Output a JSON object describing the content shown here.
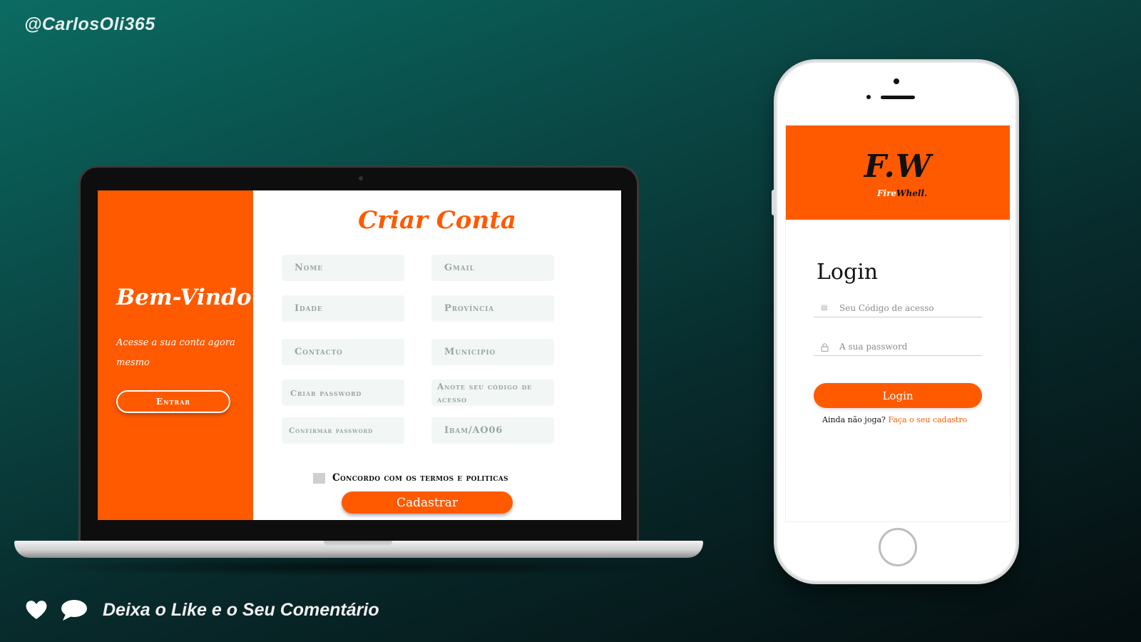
{
  "handle": "@CarlosOli365",
  "laptop": {
    "welcome": {
      "title": "Bem-Vindo",
      "subtitle": "Acesse a sua conta agora mesmo",
      "enter_button": "Entrar"
    },
    "form": {
      "title": "Criar Conta",
      "fields": {
        "nome": "Nome",
        "gmail": "Gmail",
        "idade": "Idade",
        "provincia": "Província",
        "contacto": "Contacto",
        "municipio": "Municipio",
        "criar_password": "Criar password",
        "codigo_acesso": "Anote seu código de acesso",
        "confirmar_password": "Confirmar password",
        "iban": "Ibam/AO06"
      },
      "agree_label": "Concordo com os termos e politicas",
      "submit_button": "Cadastrar"
    }
  },
  "phone": {
    "logo": "F.W",
    "logo_sub_1": "Fire",
    "logo_sub_2": "Whell.",
    "login_title": "Login",
    "code_placeholder": "Seu Código de acesso",
    "password_placeholder": "A sua password",
    "login_button": "Login",
    "register_prompt": "Ainda não joga?",
    "register_link": "Faça o seu cadastro"
  },
  "footer": {
    "text": "Deixa o Like e  o Seu Comentário"
  },
  "colors": {
    "accent": "#ff5a00",
    "field_bg": "#f2f7f6",
    "background_start": "#0b6b62",
    "background_end": "#050d0f"
  },
  "icons": [
    "heart-icon",
    "comment-icon",
    "keyboard-icon",
    "lock-icon"
  ]
}
